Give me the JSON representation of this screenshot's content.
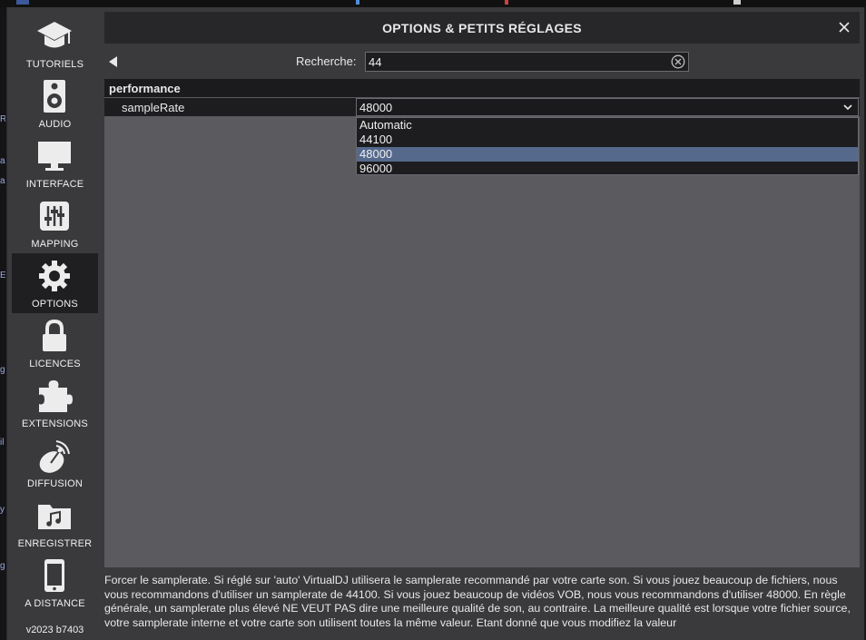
{
  "window": {
    "title": "OPTIONS & PETITS RÉGLAGES",
    "close_icon": "close-icon",
    "background_color": "#3a3a3d",
    "titlebar_color": "#27272a"
  },
  "sidebar": {
    "items": [
      {
        "label": "TUTORIELS",
        "icon": "graduation-cap-icon",
        "active": false
      },
      {
        "label": "AUDIO",
        "icon": "speaker-icon",
        "active": false
      },
      {
        "label": "INTERFACE",
        "icon": "monitor-icon",
        "active": false
      },
      {
        "label": "MAPPING",
        "icon": "sliders-icon",
        "active": false
      },
      {
        "label": "OPTIONS",
        "icon": "gear-icon",
        "active": true
      },
      {
        "label": "LICENCES",
        "icon": "lock-icon",
        "active": false
      },
      {
        "label": "EXTENSIONS",
        "icon": "puzzle-icon",
        "active": false
      },
      {
        "label": "DIFFUSION",
        "icon": "broadcast-dish-icon",
        "active": false
      },
      {
        "label": "ENREGISTRER",
        "icon": "music-folder-icon",
        "active": false
      },
      {
        "label": "A DISTANCE",
        "icon": "phone-icon",
        "active": false
      }
    ],
    "version": "v2023 b7403"
  },
  "search": {
    "label": "Recherche:",
    "value": "44",
    "back_icon": "back-arrow-icon",
    "clear_icon": "clear-circle-icon"
  },
  "section": {
    "name": "performance",
    "option": {
      "name": "sampleRate",
      "value": "48000",
      "dropdown_icon": "chevron-down-icon",
      "options": [
        "Automatic",
        "44100",
        "48000",
        "96000"
      ],
      "selected_index": 2,
      "highlight_color": "#54698c"
    }
  },
  "description": "Forcer le samplerate. Si réglé sur 'auto' VirtualDJ utilisera le samplerate recommandé par votre carte son. Si vous jouez beaucoup de fichiers, nous vous recommandons d'utiliser un samplerate de 44100. Si vous jouez beaucoup de vidéos VOB, nous vous recommandons d'utiliser 48000. En règle générale, un samplerate plus élevé NE VEUT PAS dire une meilleure qualité de son, au contraire. La meilleure qualité est lorsque votre fichier source, votre samplerate interne et votre carte son utilisent toutes la même valeur. Etant donné que vous modifiez la valeur"
}
